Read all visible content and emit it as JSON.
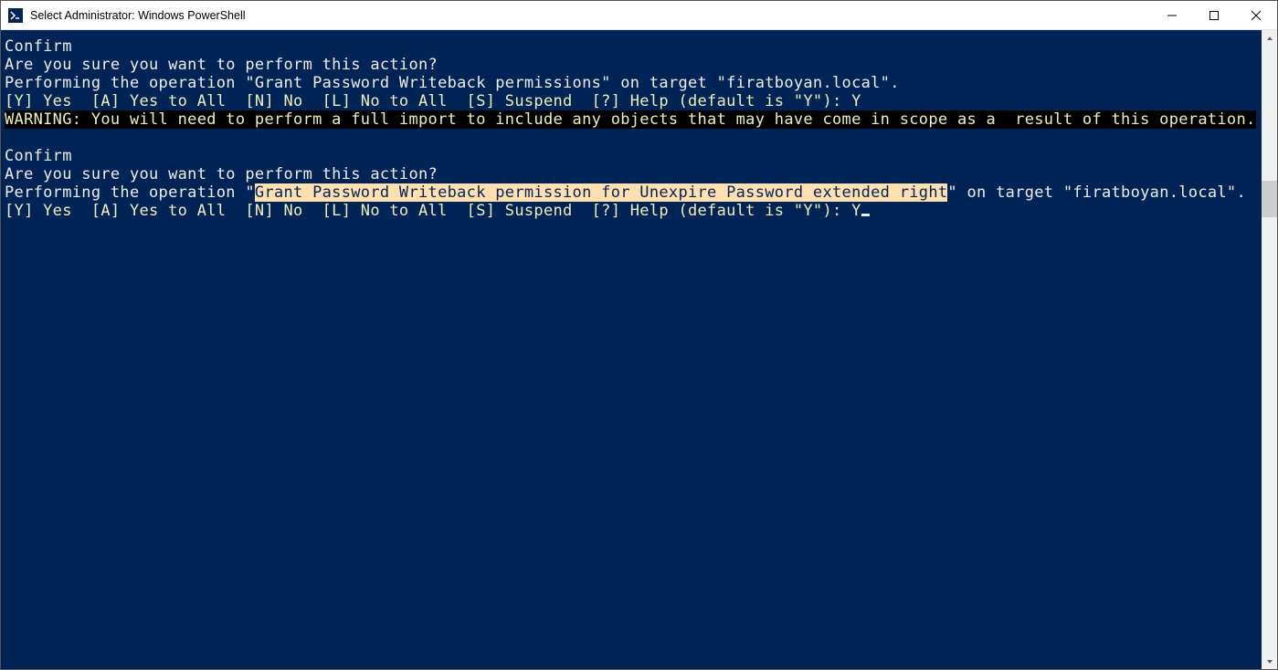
{
  "titlebar": {
    "title": "Select Administrator: Windows PowerShell"
  },
  "terminal": {
    "block1": {
      "confirm": "Confirm",
      "question": "Are you sure you want to perform this action?",
      "operation": "Performing the operation \"Grant Password Writeback permissions\" on target \"firatboyan.local\".",
      "prompt_options": "[Y] Yes  [A] Yes to All  [N] No  [L] No to All  [S] Suspend  [?] Help (default is \"Y\"): Y",
      "warning": "WARNING: You will need to perform a full import to include any objects that may have come in scope as a  result of this operation."
    },
    "block2": {
      "confirm": "Confirm",
      "question": "Are you sure you want to perform this action?",
      "operation_pre": "Performing the operation \"",
      "operation_highlight": "Grant Password Writeback permission for Unexpire Password extended right",
      "operation_post": "\" on target \"firatboyan.local\".",
      "prompt_options": "[Y] Yes  [A] Yes to All  [N] No  [L] No to All  [S] Suspend  [?] Help (default is \"Y\"): Y"
    }
  }
}
